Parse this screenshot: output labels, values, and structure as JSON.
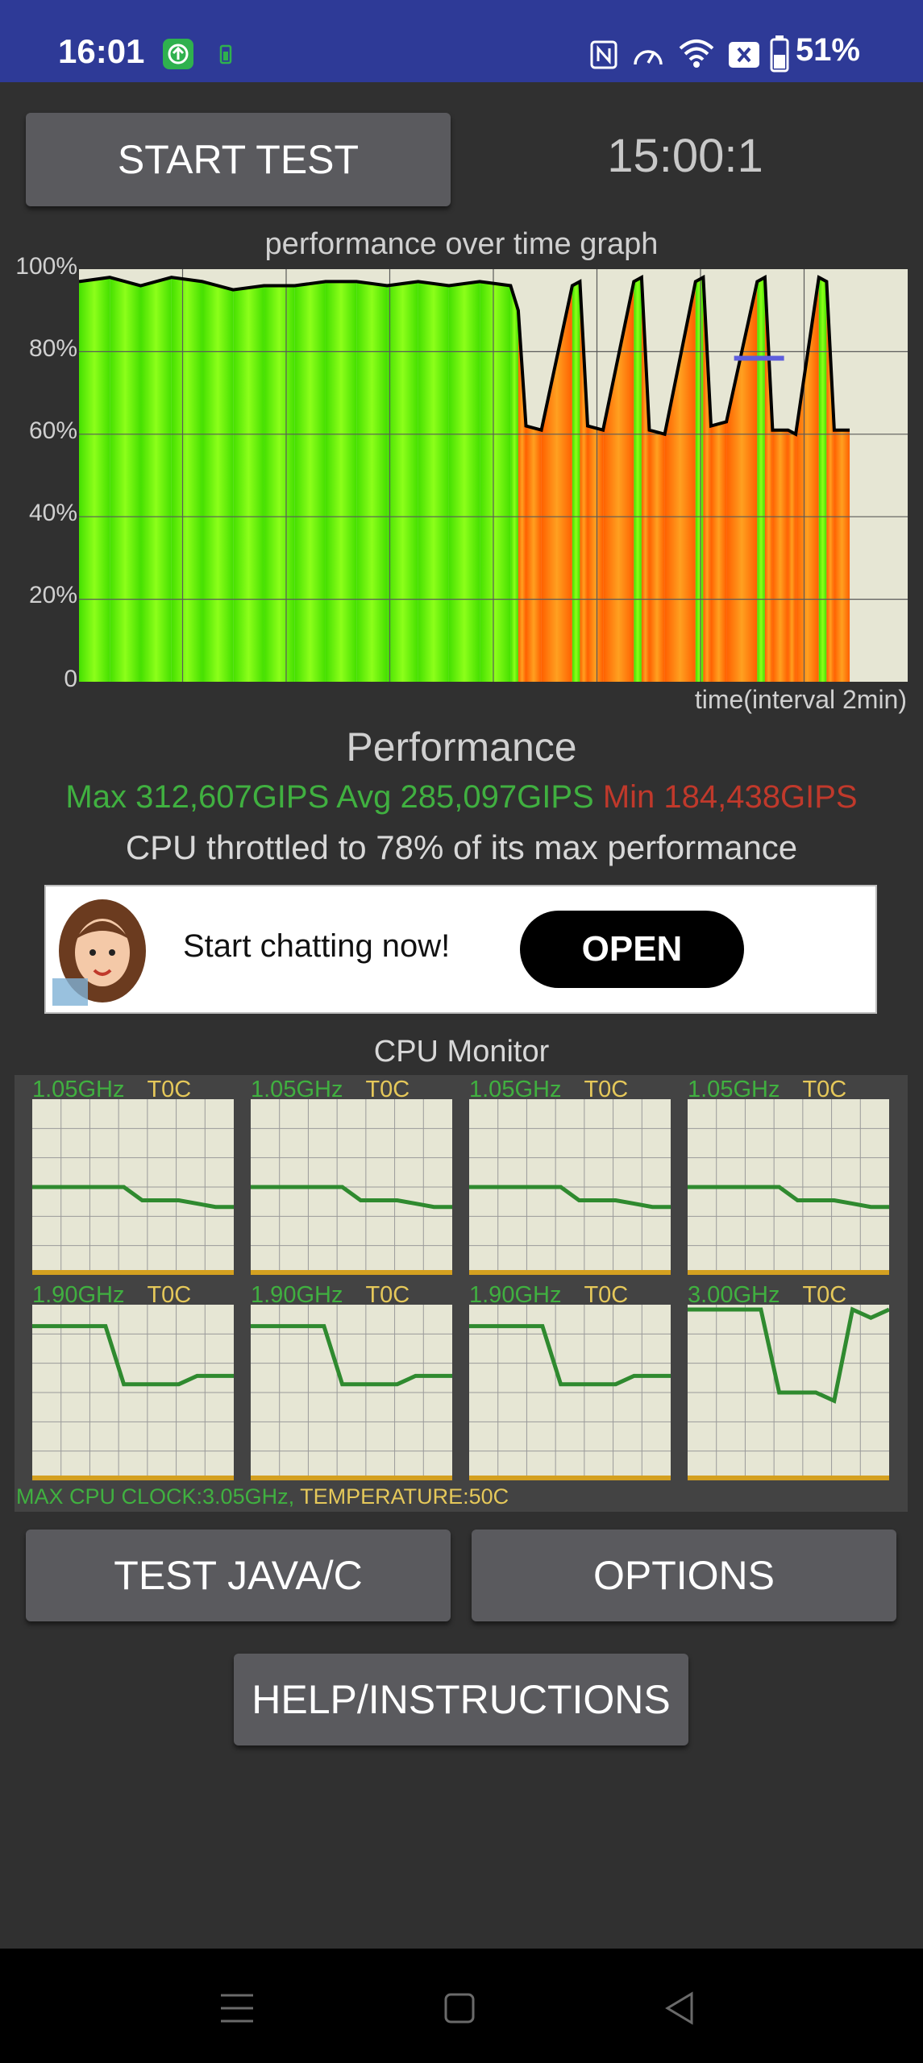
{
  "status_bar": {
    "time": "16:01",
    "battery_percent": "51%"
  },
  "controls": {
    "start_test_label": "START TEST",
    "timer": "15:00:1",
    "test_java_c_label": "TEST JAVA/C",
    "options_label": "OPTIONS",
    "help_label": "HELP/INSTRUCTIONS"
  },
  "chart_data": {
    "type": "area",
    "title": "performance over time graph",
    "xlabel": "time(interval 2min)",
    "ylabel": "",
    "ylim": [
      0,
      100
    ],
    "y_ticks": [
      "100%",
      "80%",
      "60%",
      "40%",
      "20%",
      "0"
    ],
    "grid": true,
    "series": [
      {
        "x": [
          0,
          4,
          8,
          12,
          16,
          20,
          24,
          28,
          32,
          36,
          40,
          44,
          48,
          52,
          56,
          57,
          58,
          60,
          64,
          65,
          66,
          68,
          72,
          73,
          74,
          76,
          80,
          81,
          82,
          84,
          88,
          89,
          90,
          92,
          93,
          96,
          97,
          98,
          100
        ],
        "values": [
          97,
          98,
          96,
          98,
          97,
          95,
          96,
          96,
          97,
          97,
          96,
          97,
          96,
          97,
          96,
          90,
          62,
          61,
          96,
          97,
          62,
          61,
          97,
          98,
          61,
          60,
          97,
          98,
          62,
          63,
          97,
          98,
          61,
          61,
          60,
          98,
          97,
          61,
          61
        ]
      }
    ],
    "marker_bar_value": 79
  },
  "performance": {
    "title": "Performance",
    "max": "Max 312,607GIPS",
    "avg": "Avg 285,097GIPS",
    "min": "Min 184,438GIPS",
    "throttle_text": "CPU throttled to 78% of its max performance"
  },
  "ad": {
    "text": "Start chatting now!",
    "button_label": "OPEN"
  },
  "cpu_monitor": {
    "title": "CPU Monitor",
    "cores": [
      {
        "freq": "1.05GHz",
        "temp": "T0C",
        "levels": [
          50,
          50,
          50,
          50,
          50,
          50,
          42,
          42,
          42,
          40,
          38,
          38
        ]
      },
      {
        "freq": "1.05GHz",
        "temp": "T0C",
        "levels": [
          50,
          50,
          50,
          50,
          50,
          50,
          42,
          42,
          42,
          40,
          38,
          38
        ]
      },
      {
        "freq": "1.05GHz",
        "temp": "T0C",
        "levels": [
          50,
          50,
          50,
          50,
          50,
          50,
          42,
          42,
          42,
          40,
          38,
          38
        ]
      },
      {
        "freq": "1.05GHz",
        "temp": "T0C",
        "levels": [
          50,
          50,
          50,
          50,
          50,
          50,
          42,
          42,
          42,
          40,
          38,
          38
        ]
      },
      {
        "freq": "1.90GHz",
        "temp": "T0C",
        "levels": [
          90,
          90,
          90,
          90,
          90,
          55,
          55,
          55,
          55,
          60,
          60,
          60
        ]
      },
      {
        "freq": "1.90GHz",
        "temp": "T0C",
        "levels": [
          90,
          90,
          90,
          90,
          90,
          55,
          55,
          55,
          55,
          60,
          60,
          60
        ]
      },
      {
        "freq": "1.90GHz",
        "temp": "T0C",
        "levels": [
          90,
          90,
          90,
          90,
          90,
          55,
          55,
          55,
          55,
          60,
          60,
          60
        ]
      },
      {
        "freq": "3.00GHz",
        "temp": "T0C",
        "levels": [
          100,
          100,
          100,
          100,
          100,
          50,
          50,
          50,
          45,
          100,
          95,
          100
        ]
      }
    ],
    "footer_clock": "MAX CPU CLOCK:3.05GHz,",
    "footer_temp": "TEMPERATURE:50C"
  },
  "colors": {
    "status_bar": "#2e3a97",
    "green": "#40b040",
    "red": "#c0392b",
    "yellow": "#e5c85a"
  }
}
